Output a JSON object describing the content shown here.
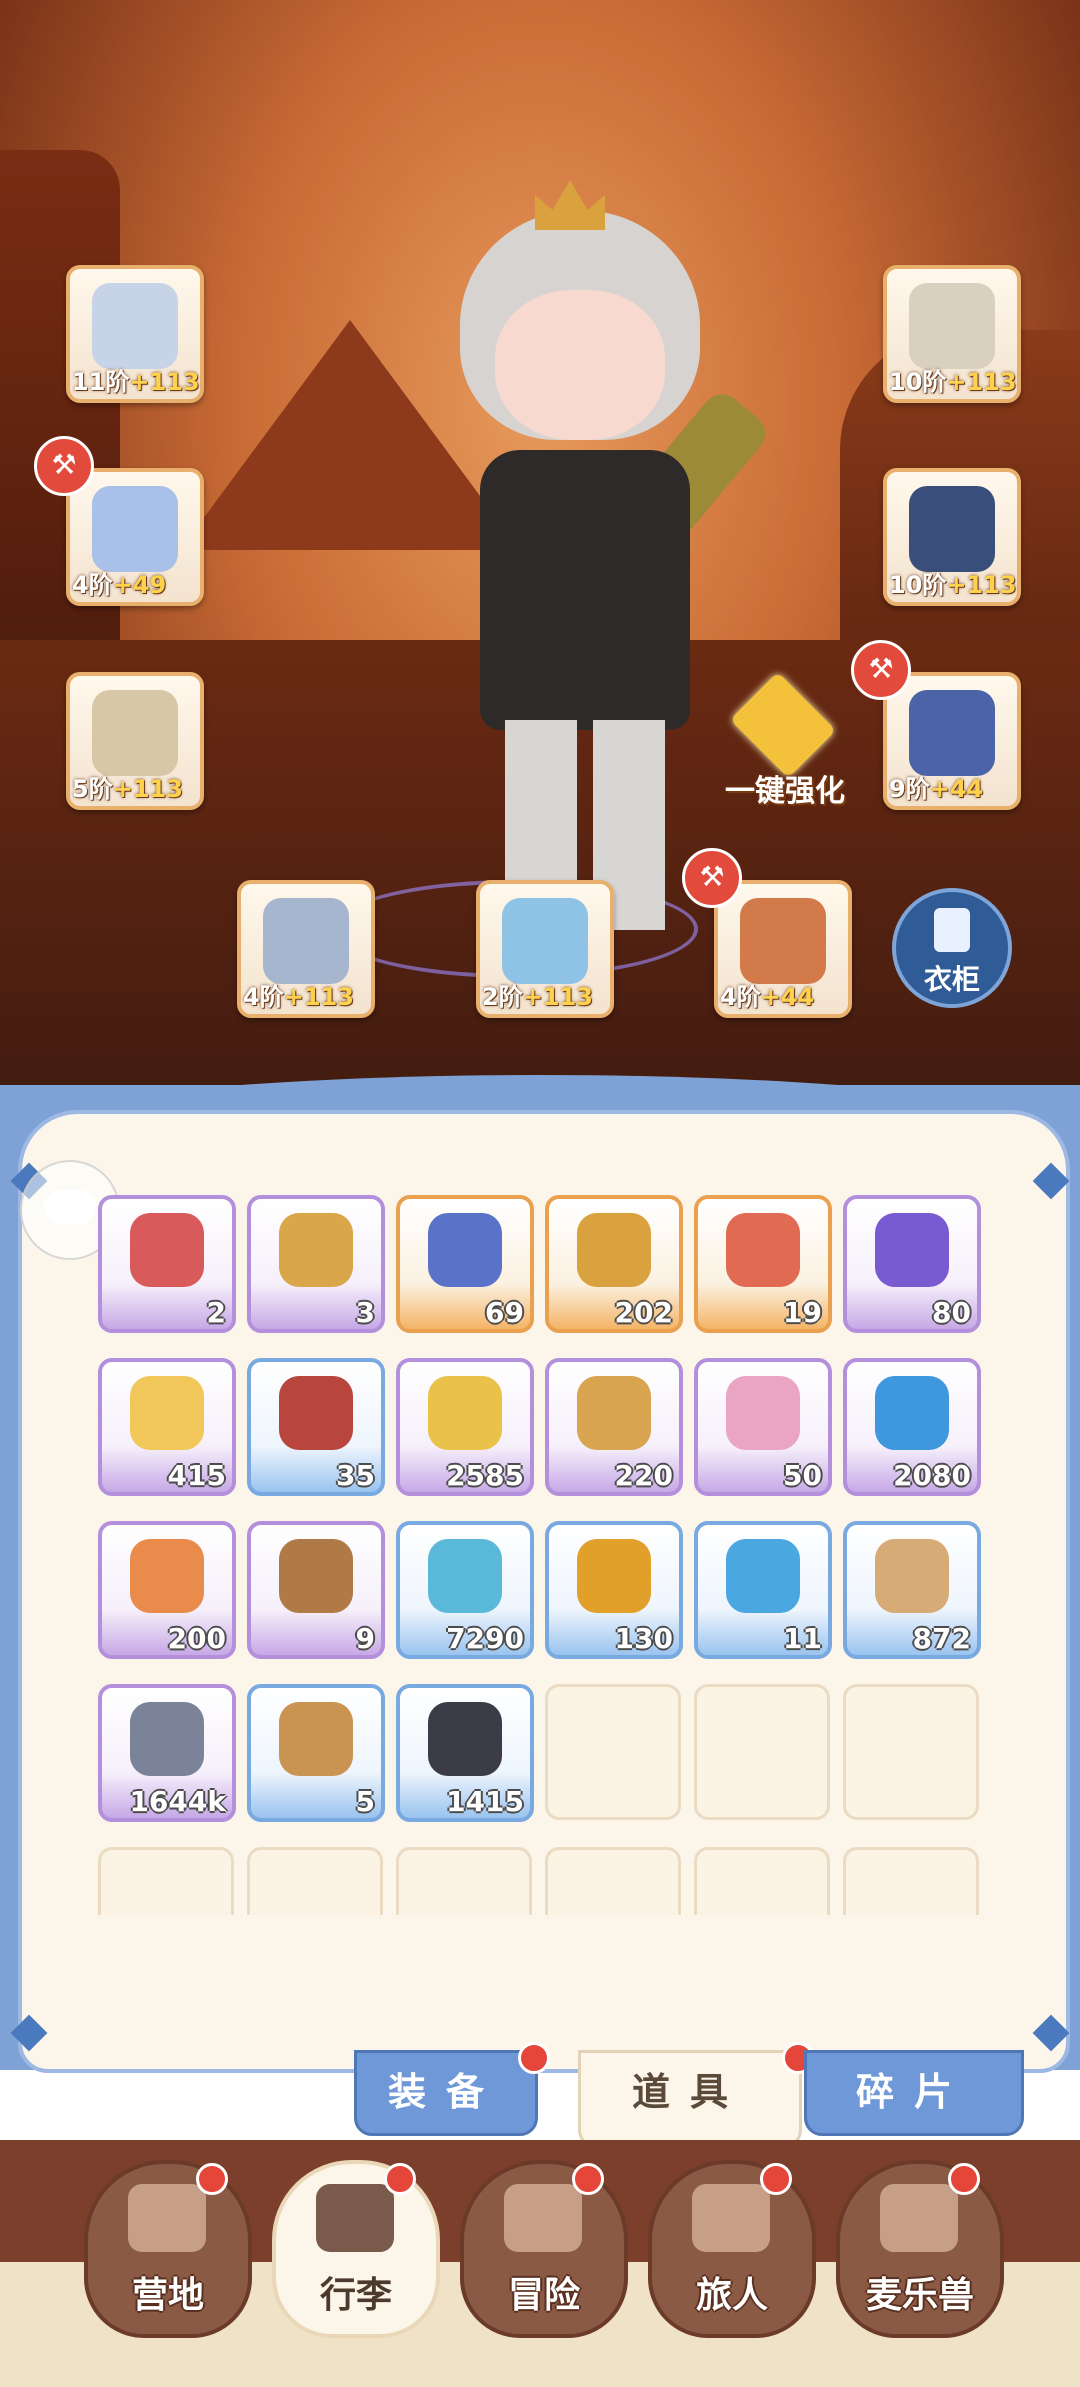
{
  "equipment": {
    "left": [
      {
        "name": "weapon-slot",
        "level": "11阶",
        "bonus": "+113",
        "badge": false
      },
      {
        "name": "armor-slot",
        "level": "4阶",
        "bonus": "+49",
        "badge": true
      },
      {
        "name": "belt-slot",
        "level": "5阶",
        "bonus": "+113",
        "badge": false
      }
    ],
    "right": [
      {
        "name": "helmet-slot",
        "level": "10阶",
        "bonus": "+113",
        "badge": false
      },
      {
        "name": "shoulder-slot",
        "level": "10阶",
        "bonus": "+113",
        "badge": false
      },
      {
        "name": "boots-slot",
        "level": "9阶",
        "bonus": "+44",
        "badge": true
      }
    ],
    "bottom": [
      {
        "name": "ring-slot",
        "level": "4阶",
        "bonus": "+113",
        "badge": false
      },
      {
        "name": "necklace-slot",
        "level": "2阶",
        "bonus": "+113",
        "badge": false
      },
      {
        "name": "charm-slot",
        "level": "4阶",
        "bonus": "+44",
        "badge": true
      }
    ]
  },
  "enhance": {
    "label": "一键强化"
  },
  "wardrobe": {
    "label": "衣柜"
  },
  "inventory": [
    {
      "icon": "potion-icon",
      "count": "2",
      "rarity": "purple"
    },
    {
      "icon": "key-icon",
      "count": "3",
      "rarity": "purple"
    },
    {
      "icon": "blue-card-icon",
      "count": "69",
      "rarity": "orange"
    },
    {
      "icon": "gold-card-icon",
      "count": "202",
      "rarity": "orange"
    },
    {
      "icon": "red-card-icon",
      "count": "19",
      "rarity": "orange"
    },
    {
      "icon": "purple-orb-icon",
      "count": "80",
      "rarity": "purple"
    },
    {
      "icon": "cheese-icon",
      "count": "415",
      "rarity": "purple"
    },
    {
      "icon": "meat-icon",
      "count": "35",
      "rarity": "blue"
    },
    {
      "icon": "leaf-icon",
      "count": "2585",
      "rarity": "purple"
    },
    {
      "icon": "star-cookie-icon",
      "count": "220",
      "rarity": "purple"
    },
    {
      "icon": "tube-icon",
      "count": "50",
      "rarity": "purple"
    },
    {
      "icon": "blue-slime-icon",
      "count": "2080",
      "rarity": "purple"
    },
    {
      "icon": "ticket-icon",
      "count": "200",
      "rarity": "purple"
    },
    {
      "icon": "book-icon",
      "count": "9",
      "rarity": "purple"
    },
    {
      "icon": "crystal-icon",
      "count": "7290",
      "rarity": "blue"
    },
    {
      "icon": "amber-icon",
      "count": "130",
      "rarity": "blue"
    },
    {
      "icon": "blue-orb-icon",
      "count": "11",
      "rarity": "blue"
    },
    {
      "icon": "paw-bag-icon",
      "count": "872",
      "rarity": "blue"
    },
    {
      "icon": "ingot-icon",
      "count": "1644k",
      "rarity": "purple"
    },
    {
      "icon": "star-card-icon",
      "count": "5",
      "rarity": "blue"
    },
    {
      "icon": "ore-icon",
      "count": "1415",
      "rarity": "blue"
    }
  ],
  "tabs": [
    {
      "label": "装备",
      "active": false,
      "dot": true
    },
    {
      "label": "道具",
      "active": true,
      "dot": true
    },
    {
      "label": "碎片",
      "active": false,
      "dot": false
    }
  ],
  "nav": [
    {
      "label": "营地",
      "icon": "castle-icon",
      "active": false
    },
    {
      "label": "行李",
      "icon": "luggage-icon",
      "active": true
    },
    {
      "label": "冒险",
      "icon": "swords-icon",
      "active": false
    },
    {
      "label": "旅人",
      "icon": "traveler-icon",
      "active": false
    },
    {
      "label": "麦乐兽",
      "icon": "pet-icon",
      "active": false
    }
  ],
  "colors": {
    "purple": "#b38fdc",
    "orange": "#e9a04f",
    "blue": "#78a9e0",
    "reddot": "#e5463a"
  }
}
